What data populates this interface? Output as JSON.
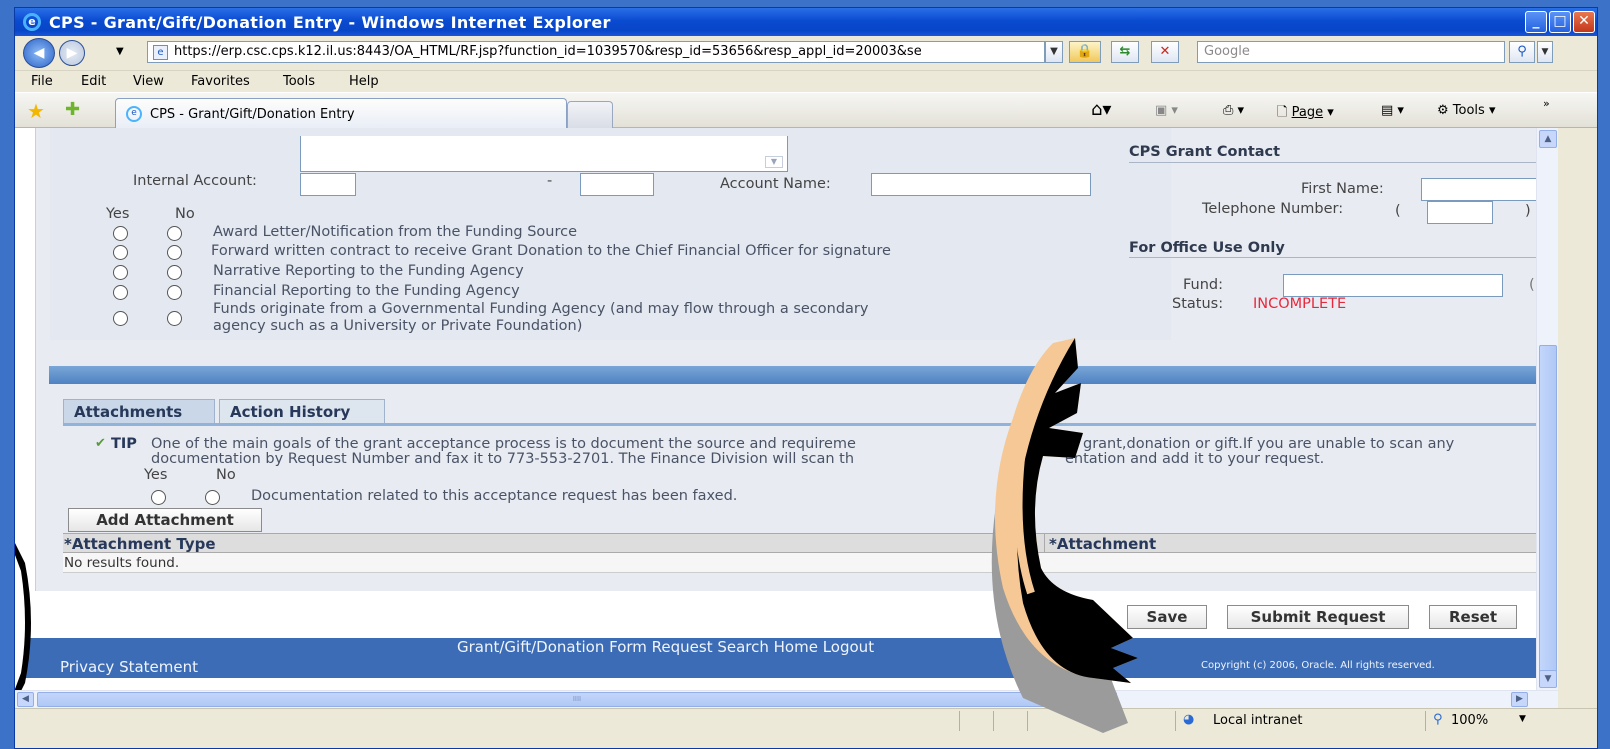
{
  "window": {
    "title": "CPS - Grant/Gift/Donation Entry - Windows Internet Explorer",
    "controls": [
      "_",
      "□",
      "X"
    ]
  },
  "browser": {
    "url": "https://erp.csc.cps.k12.il.us:8443/OA_HTML/RF.jsp?function_id=1039570&resp_id=53656&resp_appl_id=20003&se",
    "search_placeholder": "Google",
    "menu": [
      "File",
      "Edit",
      "View",
      "Favorites",
      "Tools",
      "Help"
    ],
    "tab_title": "CPS - Grant/Gift/Donation Entry",
    "toolbar": {
      "page": "Page",
      "tools": "Tools"
    }
  },
  "form": {
    "internal_account_label": "Internal Account:",
    "dash": "-",
    "account_name_label": "Account Name:",
    "yes_label": "Yes",
    "no_label": "No",
    "checklist": [
      "Award Letter/Notification from the Funding Source",
      "Forward written contract to receive Grant Donation to the Chief Financial Officer for signature",
      "Narrative Reporting to the Funding Agency",
      "Financial Reporting to the Funding Agency",
      "Funds originate from a Governmental Funding Agency (and may flow through a secondary",
      "agency such as a University or Private Foundation)"
    ]
  },
  "contact": {
    "heading": "CPS Grant Contact",
    "first_name_label": "First Name:",
    "telephone_label": "Telephone Number:",
    "paren_open": "(",
    "paren_close": ")"
  },
  "office": {
    "heading": "For Office Use Only",
    "fund_label": "Fund:",
    "status_label": "Status:",
    "status_value": "INCOMPLETE",
    "status_color": "#e8283c",
    "cut_char": "("
  },
  "tabs": [
    "Attachments",
    "Action History"
  ],
  "tip": {
    "label": "TIP",
    "line1": "One of the main goals of the grant acceptance process is to document the source and requireme",
    "line1b": "grant,donation or gift.If you are unable to scan any",
    "line2": "documentation by Request Number and fax it to 773-553-2701. The Finance Division will scan th",
    "line2b": "entation and add it to your request.",
    "yes": "Yes",
    "no": "No",
    "faxed_text": "Documentation related to this acceptance request has been faxed."
  },
  "attachments": {
    "add_button": "Add Attachment",
    "col_type": "*Attachment Type",
    "col_attachment": "*Attachment",
    "empty": "No results found."
  },
  "actions": {
    "save": "Save",
    "submit": "Submit Request",
    "reset": "Reset"
  },
  "footer": {
    "links": "Grant/Gift/Donation Form   Request Search   Home   Logout",
    "privacy": "Privacy Statement",
    "copyright": "Copyright (c) 2006, Oracle. All rights reserved."
  },
  "statusbar": {
    "zone": "Local intranet",
    "zoom": "100%"
  },
  "colors": {
    "accent": "#3c6cb5",
    "title_bar": "#0a4bd1"
  }
}
